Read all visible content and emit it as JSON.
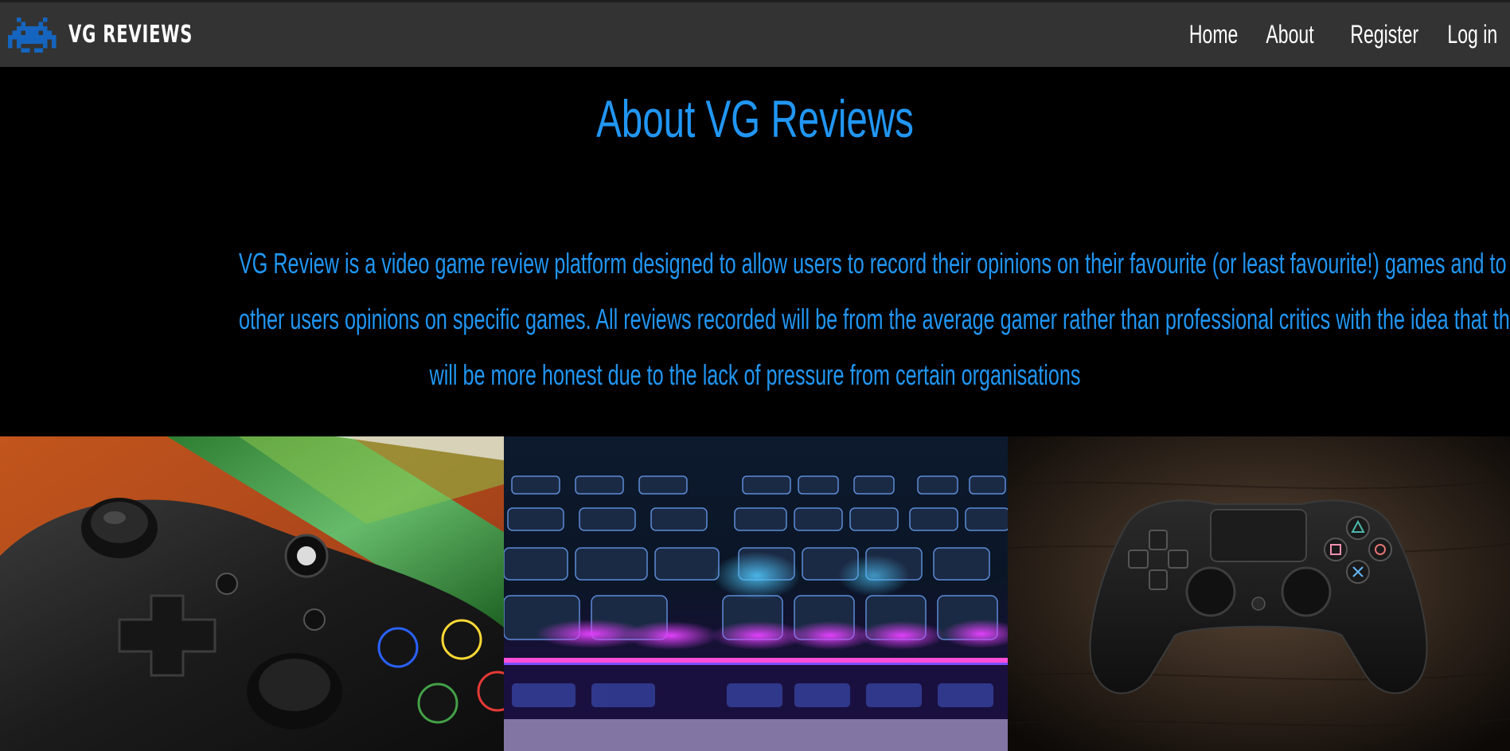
{
  "brand": {
    "name": "VG REVIEWS",
    "logo_icon": "space-invader-icon",
    "logo_color": "#1565c0"
  },
  "nav": {
    "items": [
      {
        "label": "Home"
      },
      {
        "label": "About"
      },
      {
        "label": "Register"
      },
      {
        "label": "Log in"
      }
    ]
  },
  "about": {
    "title": "About VG Reviews",
    "description_lines": [
      "VG Review is a video game review platform designed to allow users to record their opinions on their favourite (or least favourite!) games and to read",
      "other users opinions on specific games. All reviews recorded will be from the average gamer rather than professional critics with the idea that these",
      "will be more honest due to the lack of pressure from certain organisations"
    ]
  },
  "colors": {
    "accent": "#2196f3",
    "navbar_bg": "#333333",
    "page_bg": "#000000"
  },
  "gallery": {
    "images": [
      {
        "subject": "xbox-controller-image"
      },
      {
        "subject": "rgb-keyboard-image"
      },
      {
        "subject": "playstation-controller-image"
      }
    ]
  }
}
